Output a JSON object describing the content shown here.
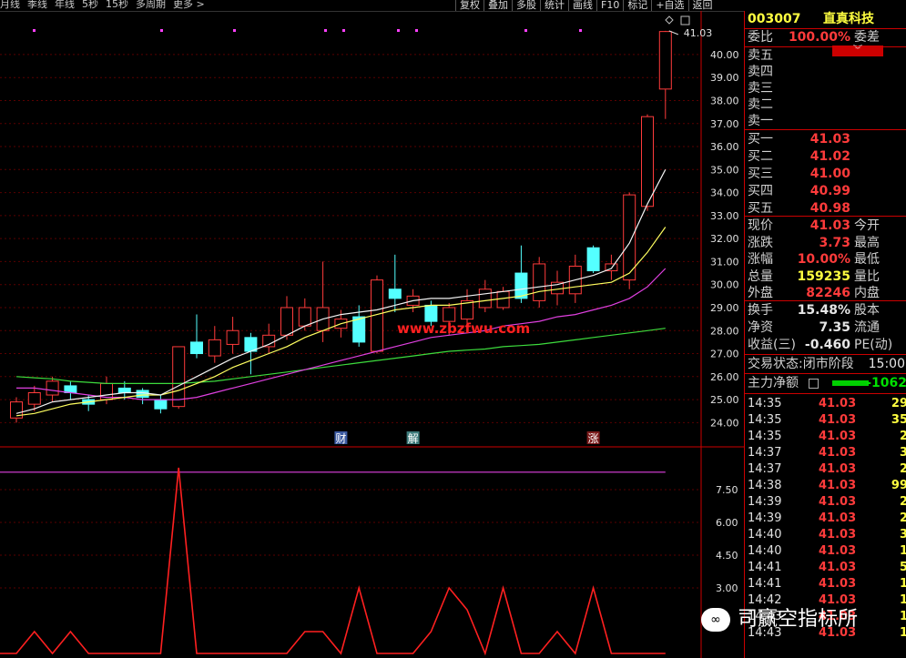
{
  "toolbar": {
    "periods": [
      "月线",
      "季线",
      "年线",
      "5秒",
      "15秒",
      "多周期",
      "更多 >"
    ],
    "buttons": [
      "复权",
      "叠加",
      "多股",
      "统计",
      "画线",
      "F10",
      "标记",
      "+自选",
      "返回"
    ]
  },
  "stock": {
    "code": "003007",
    "name": "直真科技"
  },
  "quote": {
    "weibi_label": "委比",
    "weibi": "100.00%",
    "weicha_label": "委差",
    "sell_labels": [
      "卖五",
      "卖四",
      "卖三",
      "卖二",
      "卖一"
    ],
    "buy": [
      {
        "label": "买一",
        "price": "41.03"
      },
      {
        "label": "买二",
        "price": "41.02"
      },
      {
        "label": "买三",
        "price": "41.00"
      },
      {
        "label": "买四",
        "price": "40.99"
      },
      {
        "label": "买五",
        "price": "40.98"
      }
    ],
    "stats": [
      {
        "label": "现价",
        "value": "41.03",
        "label2": "今开",
        "color": "red"
      },
      {
        "label": "涨跌",
        "value": "3.73",
        "label2": "最高",
        "color": "red"
      },
      {
        "label": "涨幅",
        "value": "10.00%",
        "label2": "最低",
        "color": "red"
      },
      {
        "label": "总量",
        "value": "159235",
        "label2": "量比",
        "color": "yel"
      },
      {
        "label": "外盘",
        "value": "82246",
        "label2": "内盘",
        "color": "red"
      }
    ],
    "stats2": [
      {
        "label": "换手",
        "value": "15.48%",
        "label2": "股本",
        "color": "wht"
      },
      {
        "label": "净资",
        "value": "7.35",
        "label2": "流通",
        "color": "wht"
      },
      {
        "label": "收益(三)",
        "value": "-0.460",
        "label2": "PE(动)",
        "color": "wht"
      }
    ],
    "status_label": "交易状态:闭市阶段",
    "status_time": "15:00",
    "net_label": "主力净额",
    "net_value": "-1062"
  },
  "ticks": [
    {
      "t": "14:35",
      "p": "41.03",
      "v": "29"
    },
    {
      "t": "14:35",
      "p": "41.03",
      "v": "35"
    },
    {
      "t": "14:35",
      "p": "41.03",
      "v": "2"
    },
    {
      "t": "14:37",
      "p": "41.03",
      "v": "3"
    },
    {
      "t": "14:37",
      "p": "41.03",
      "v": "2"
    },
    {
      "t": "14:38",
      "p": "41.03",
      "v": "99"
    },
    {
      "t": "14:39",
      "p": "41.03",
      "v": "2"
    },
    {
      "t": "14:39",
      "p": "41.03",
      "v": "2"
    },
    {
      "t": "14:40",
      "p": "41.03",
      "v": "3"
    },
    {
      "t": "14:40",
      "p": "41.03",
      "v": "1"
    },
    {
      "t": "14:41",
      "p": "41.03",
      "v": "5"
    },
    {
      "t": "14:41",
      "p": "41.03",
      "v": "1"
    },
    {
      "t": "14:42",
      "p": "41.03",
      "v": "1"
    },
    {
      "t": "14:43",
      "p": "41.03",
      "v": "1"
    },
    {
      "t": "14:43",
      "p": "41.03",
      "v": "1"
    }
  ],
  "chart_data": {
    "type": "candlestick",
    "price_ticks": [
      "40.00",
      "39.00",
      "38.00",
      "37.00",
      "36.00",
      "35.00",
      "34.00",
      "33.00",
      "32.00",
      "31.00",
      "30.00",
      "29.00",
      "28.00",
      "27.00",
      "26.00",
      "25.00",
      "24.00"
    ],
    "price_range": [
      23.5,
      41.5
    ],
    "last_price_label": "41.03",
    "candles": [
      {
        "o": 24.2,
        "c": 24.9,
        "h": 25.1,
        "l": 24.0
      },
      {
        "o": 24.8,
        "c": 25.3,
        "h": 25.6,
        "l": 24.5
      },
      {
        "o": 25.2,
        "c": 25.8,
        "h": 26.0,
        "l": 24.9
      },
      {
        "o": 25.6,
        "c": 25.3,
        "h": 25.8,
        "l": 25.0
      },
      {
        "o": 25.0,
        "c": 24.8,
        "h": 25.2,
        "l": 24.5
      },
      {
        "o": 25.0,
        "c": 25.7,
        "h": 26.0,
        "l": 24.8
      },
      {
        "o": 25.5,
        "c": 25.3,
        "h": 25.8,
        "l": 25.0
      },
      {
        "o": 25.4,
        "c": 25.1,
        "h": 25.5,
        "l": 24.8
      },
      {
        "o": 25.0,
        "c": 24.6,
        "h": 25.2,
        "l": 24.4
      },
      {
        "o": 24.7,
        "c": 27.3,
        "h": 27.3,
        "l": 24.6
      },
      {
        "o": 27.5,
        "c": 27.0,
        "h": 28.7,
        "l": 26.8
      },
      {
        "o": 26.9,
        "c": 27.6,
        "h": 28.2,
        "l": 26.6
      },
      {
        "o": 27.4,
        "c": 28.0,
        "h": 28.6,
        "l": 27.0
      },
      {
        "o": 27.7,
        "c": 27.1,
        "h": 27.9,
        "l": 26.1
      },
      {
        "o": 27.3,
        "c": 27.8,
        "h": 28.3,
        "l": 27.0
      },
      {
        "o": 27.8,
        "c": 29.0,
        "h": 29.5,
        "l": 27.6
      },
      {
        "o": 28.2,
        "c": 29.0,
        "h": 29.4,
        "l": 28.0
      },
      {
        "o": 28.0,
        "c": 29.0,
        "h": 31.0,
        "l": 27.5
      },
      {
        "o": 28.1,
        "c": 28.5,
        "h": 28.9,
        "l": 27.7
      },
      {
        "o": 28.6,
        "c": 27.5,
        "h": 29.1,
        "l": 27.3
      },
      {
        "o": 27.1,
        "c": 30.2,
        "h": 30.4,
        "l": 27.0
      },
      {
        "o": 29.8,
        "c": 29.4,
        "h": 31.3,
        "l": 28.8
      },
      {
        "o": 29.1,
        "c": 29.5,
        "h": 29.8,
        "l": 28.8
      },
      {
        "o": 29.1,
        "c": 28.4,
        "h": 29.3,
        "l": 28.2
      },
      {
        "o": 28.4,
        "c": 29.0,
        "h": 29.2,
        "l": 27.8
      },
      {
        "o": 28.5,
        "c": 29.3,
        "h": 29.8,
        "l": 28.2
      },
      {
        "o": 29.0,
        "c": 29.8,
        "h": 30.2,
        "l": 28.8
      },
      {
        "o": 29.0,
        "c": 29.7,
        "h": 29.9,
        "l": 28.9
      },
      {
        "o": 30.5,
        "c": 29.4,
        "h": 31.7,
        "l": 29.2
      },
      {
        "o": 29.3,
        "c": 30.9,
        "h": 31.2,
        "l": 29.0
      },
      {
        "o": 29.6,
        "c": 30.1,
        "h": 30.6,
        "l": 29.1
      },
      {
        "o": 29.6,
        "c": 30.8,
        "h": 31.3,
        "l": 29.2
      },
      {
        "o": 31.6,
        "c": 30.6,
        "h": 31.7,
        "l": 30.5
      },
      {
        "o": 30.6,
        "c": 30.9,
        "h": 31.3,
        "l": 30.2
      },
      {
        "o": 30.2,
        "c": 33.9,
        "h": 34.0,
        "l": 29.8
      },
      {
        "o": 33.4,
        "c": 37.3,
        "h": 37.4,
        "l": 33.2
      },
      {
        "o": 38.5,
        "c": 41.0,
        "h": 41.03,
        "l": 37.2
      }
    ],
    "ma_white": [
      24.4,
      24.6,
      24.9,
      25.0,
      25.1,
      25.2,
      25.3,
      25.3,
      25.2,
      25.6,
      26.0,
      26.4,
      26.8,
      27.1,
      27.4,
      27.8,
      28.2,
      28.5,
      28.7,
      28.8,
      28.9,
      29.1,
      29.3,
      29.4,
      29.4,
      29.5,
      29.6,
      29.7,
      29.8,
      29.9,
      30.0,
      30.2,
      30.4,
      30.7,
      31.8,
      33.5,
      35.0
    ],
    "ma_yellow": [
      24.3,
      24.4,
      24.6,
      24.8,
      24.9,
      25.0,
      25.1,
      25.2,
      25.2,
      25.4,
      25.7,
      26.0,
      26.4,
      26.7,
      27.0,
      27.3,
      27.7,
      28.0,
      28.3,
      28.5,
      28.7,
      28.9,
      29.0,
      29.1,
      29.1,
      29.2,
      29.3,
      29.4,
      29.5,
      29.7,
      29.8,
      29.9,
      30.0,
      30.1,
      30.5,
      31.4,
      32.5
    ],
    "ma_magenta": [
      25.5,
      25.5,
      25.4,
      25.3,
      25.2,
      25.1,
      25.1,
      25.0,
      25.0,
      25.0,
      25.1,
      25.3,
      25.5,
      25.7,
      25.9,
      26.1,
      26.3,
      26.5,
      26.7,
      26.9,
      27.1,
      27.3,
      27.5,
      27.7,
      27.8,
      27.9,
      28.0,
      28.2,
      28.3,
      28.4,
      28.6,
      28.7,
      28.9,
      29.1,
      29.4,
      29.9,
      30.7
    ],
    "ma_green": [
      26.0,
      25.95,
      25.9,
      25.8,
      25.75,
      25.7,
      25.7,
      25.7,
      25.7,
      25.7,
      25.75,
      25.8,
      25.9,
      26.0,
      26.1,
      26.2,
      26.3,
      26.4,
      26.5,
      26.6,
      26.7,
      26.8,
      26.9,
      27.0,
      27.1,
      27.15,
      27.2,
      27.3,
      27.35,
      27.4,
      27.5,
      27.6,
      27.7,
      27.8,
      27.9,
      28.0,
      28.1
    ],
    "markers": [
      "财",
      "解",
      "涨"
    ],
    "watermark": "www.zbzfwu.com",
    "indicator_ticks": [
      "7.50",
      "6.00",
      "4.50",
      "3.00"
    ],
    "indicator_range": [
      0,
      9
    ],
    "indicator_values": [
      0,
      1,
      0,
      1,
      0,
      0,
      0,
      0,
      0,
      8.5,
      0,
      0,
      0,
      0,
      0,
      0,
      1,
      1,
      0,
      3,
      0,
      0,
      0,
      1,
      3,
      2,
      0,
      3,
      0,
      0,
      1,
      0,
      3,
      0,
      0,
      0,
      0
    ],
    "indicator_level": 8.3
  },
  "watermark_text": "司赢空指标所",
  "wechat_icon": "wechat-icon"
}
